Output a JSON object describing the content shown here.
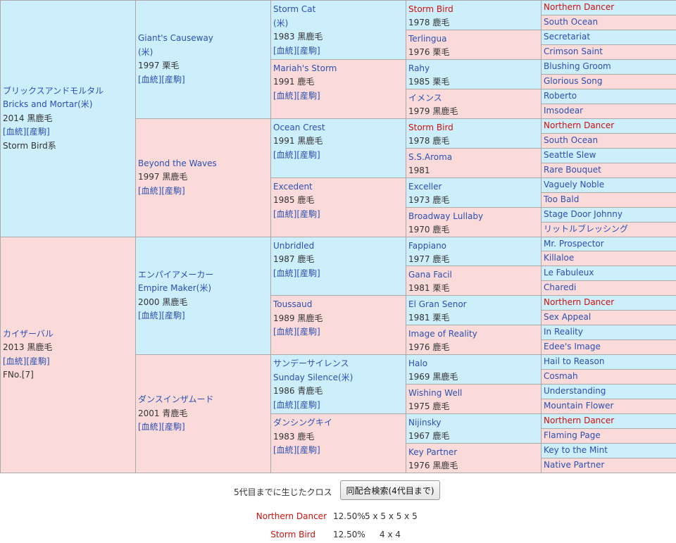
{
  "links": {
    "bloodline": "[血統]",
    "foal": "[産駒]"
  },
  "g1": [
    {
      "name_ja": "ブリックスアンドモルタル",
      "name_en": "Bricks and Mortar(米)",
      "detail": "2014 黒鹿毛",
      "extra": "Storm Bird系"
    },
    {
      "name_ja": "カイザーバル",
      "detail": "2013 黒鹿毛",
      "extra": "FNo.[7]"
    }
  ],
  "g2": [
    {
      "name_en": "Giant's Causeway",
      "country": "(米)",
      "detail": "1997 栗毛"
    },
    {
      "name_en": "Beyond the Waves",
      "detail": "1997 黒鹿毛"
    },
    {
      "name_ja": "エンパイアメーカー",
      "name_en": "Empire Maker(米)",
      "detail": "2000 黒鹿毛"
    },
    {
      "name_ja": "ダンスインザムード",
      "detail": "2001 青鹿毛"
    }
  ],
  "g3": [
    {
      "name_en": "Storm Cat",
      "country": "(米)",
      "detail": "1983 黒鹿毛"
    },
    {
      "name_en": "Mariah's Storm",
      "detail": "1991 鹿毛"
    },
    {
      "name_en": "Ocean Crest",
      "detail": "1991 黒鹿毛"
    },
    {
      "name_en": "Excedent",
      "detail": "1985 鹿毛"
    },
    {
      "name_en": "Unbridled",
      "detail": "1987 鹿毛"
    },
    {
      "name_en": "Toussaud",
      "detail": "1989 黒鹿毛"
    },
    {
      "name_ja": "サンデーサイレンス",
      "name_en": "Sunday Silence(米)",
      "detail": "1986 青鹿毛"
    },
    {
      "name_ja": "ダンシングキイ",
      "detail": "1983 鹿毛"
    }
  ],
  "g4": [
    {
      "name": "Storm Bird",
      "detail": "1978 鹿毛"
    },
    {
      "name": "Terlingua",
      "detail": "1976 栗毛"
    },
    {
      "name": "Rahy",
      "detail": "1985 栗毛"
    },
    {
      "name": "イメンス",
      "detail": "1979 黒鹿毛"
    },
    {
      "name": "Storm Bird",
      "detail": "1978 鹿毛"
    },
    {
      "name": "S.S.Aroma",
      "detail": "1981"
    },
    {
      "name": "Exceller",
      "detail": "1973 鹿毛"
    },
    {
      "name": "Broadway Lullaby",
      "detail": "1970 鹿毛"
    },
    {
      "name": "Fappiano",
      "detail": "1977 鹿毛"
    },
    {
      "name": "Gana Facil",
      "detail": "1981 栗毛"
    },
    {
      "name": "El Gran Senor",
      "detail": "1981 栗毛"
    },
    {
      "name": "Image of Reality",
      "detail": "1976 鹿毛"
    },
    {
      "name": "Halo",
      "detail": "1969 黒鹿毛"
    },
    {
      "name": "Wishing Well",
      "detail": "1975 鹿毛"
    },
    {
      "name": "Nijinsky",
      "detail": "1967 鹿毛"
    },
    {
      "name": "Key Partner",
      "detail": "1976 黒鹿毛"
    }
  ],
  "g5": [
    "Northern Dancer",
    "South Ocean",
    "Secretariat",
    "Crimson Saint",
    "Blushing Groom",
    "Glorious Song",
    "Roberto",
    "Imsodear",
    "Northern Dancer",
    "South Ocean",
    "Seattle Slew",
    "Rare Bouquet",
    "Vaguely Noble",
    "Too Bald",
    "Stage Door Johnny",
    "リットルブレッシング",
    "Mr. Prospector",
    "Killaloe",
    "Le Fabuleux",
    "Charedi",
    "Northern Dancer",
    "Sex Appeal",
    "In Reality",
    "Edee's Image",
    "Hail to Reason",
    "Cosmah",
    "Understanding",
    "Mountain Flower",
    "Northern Dancer",
    "Flaming Page",
    "Key to the Mint",
    "Native Partner"
  ],
  "cross": {
    "title": "5代目までに生じたクロス",
    "search_label": "同配合検索(4代目まで)",
    "items": [
      {
        "name": "Northern Dancer",
        "pct": "12.50%",
        "gen": "5 x 5 x 5 x 5"
      },
      {
        "name": "Storm Bird",
        "pct": "12.50%",
        "gen": "4 x 4"
      }
    ]
  },
  "colors": {
    "male_bg": "#cdeefb",
    "female_bg": "#fbdbd9",
    "link": "#2a4fb5",
    "cross_red": "#d0100b"
  }
}
